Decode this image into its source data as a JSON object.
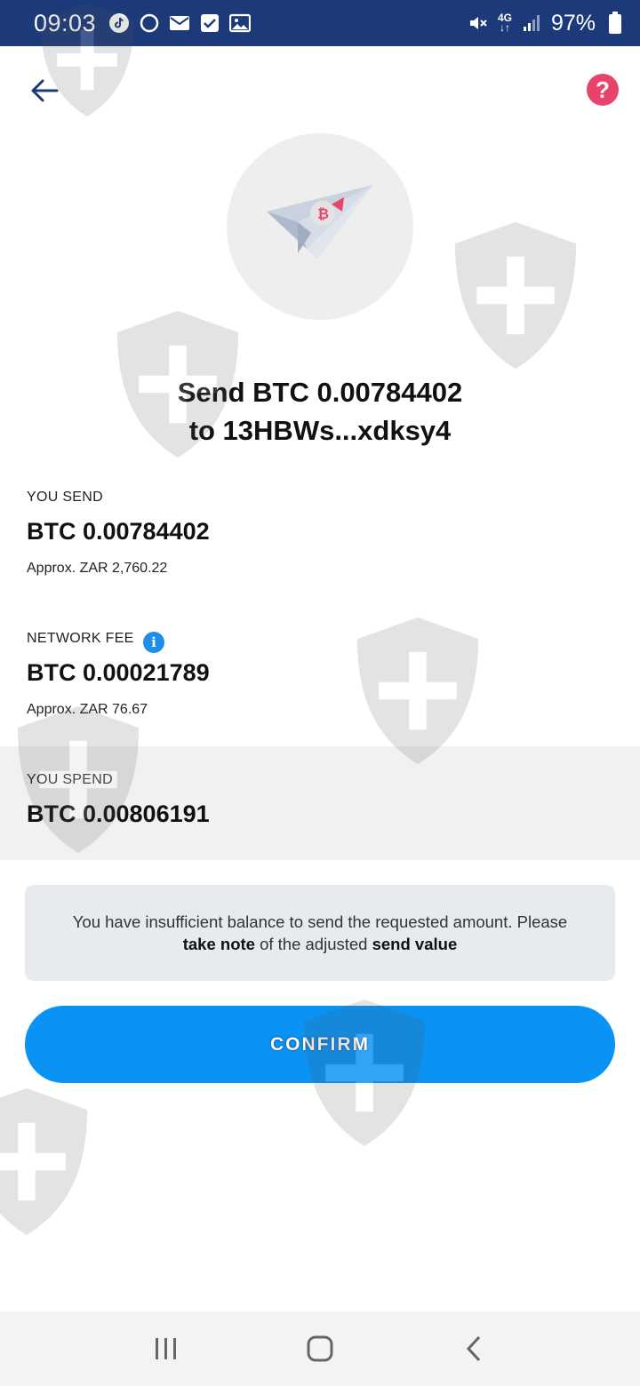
{
  "status_bar": {
    "time": "09:03",
    "network_top": "4G",
    "network_bottom": "↓↑",
    "battery": "97%"
  },
  "header": {
    "back_icon": "arrow-left-icon",
    "help_label": "?"
  },
  "hero": {
    "icon": "paper-plane-bitcoin-icon"
  },
  "headline": {
    "line1": "Send BTC 0.00784402",
    "line2": "to 13HBWs...xdksy4"
  },
  "you_send": {
    "label": "YOU SEND",
    "value": "BTC 0.00784402",
    "approx": "Approx. ZAR 2,760.22"
  },
  "network_fee": {
    "label": "NETWORK FEE",
    "info_icon": "i",
    "value": "BTC 0.00021789",
    "approx": "Approx. ZAR 76.67"
  },
  "you_spend": {
    "label": "YOU SPEND",
    "value": "BTC 0.00806191"
  },
  "notice": {
    "line1": "You have insufficient balance to send the requested amount. Please",
    "line2_bold1": "take note",
    "line2_mid": "of the adjusted",
    "line2_bold2": "send value"
  },
  "confirm": {
    "label": "CONFIRM"
  },
  "nav": {
    "recent": "recent-apps-icon",
    "home": "home-icon",
    "back": "back-icon"
  },
  "colors": {
    "status_bar": "#1c3a7a",
    "accent": "#0a93f5",
    "help": "#e8436b",
    "info": "#1e8ee8"
  }
}
